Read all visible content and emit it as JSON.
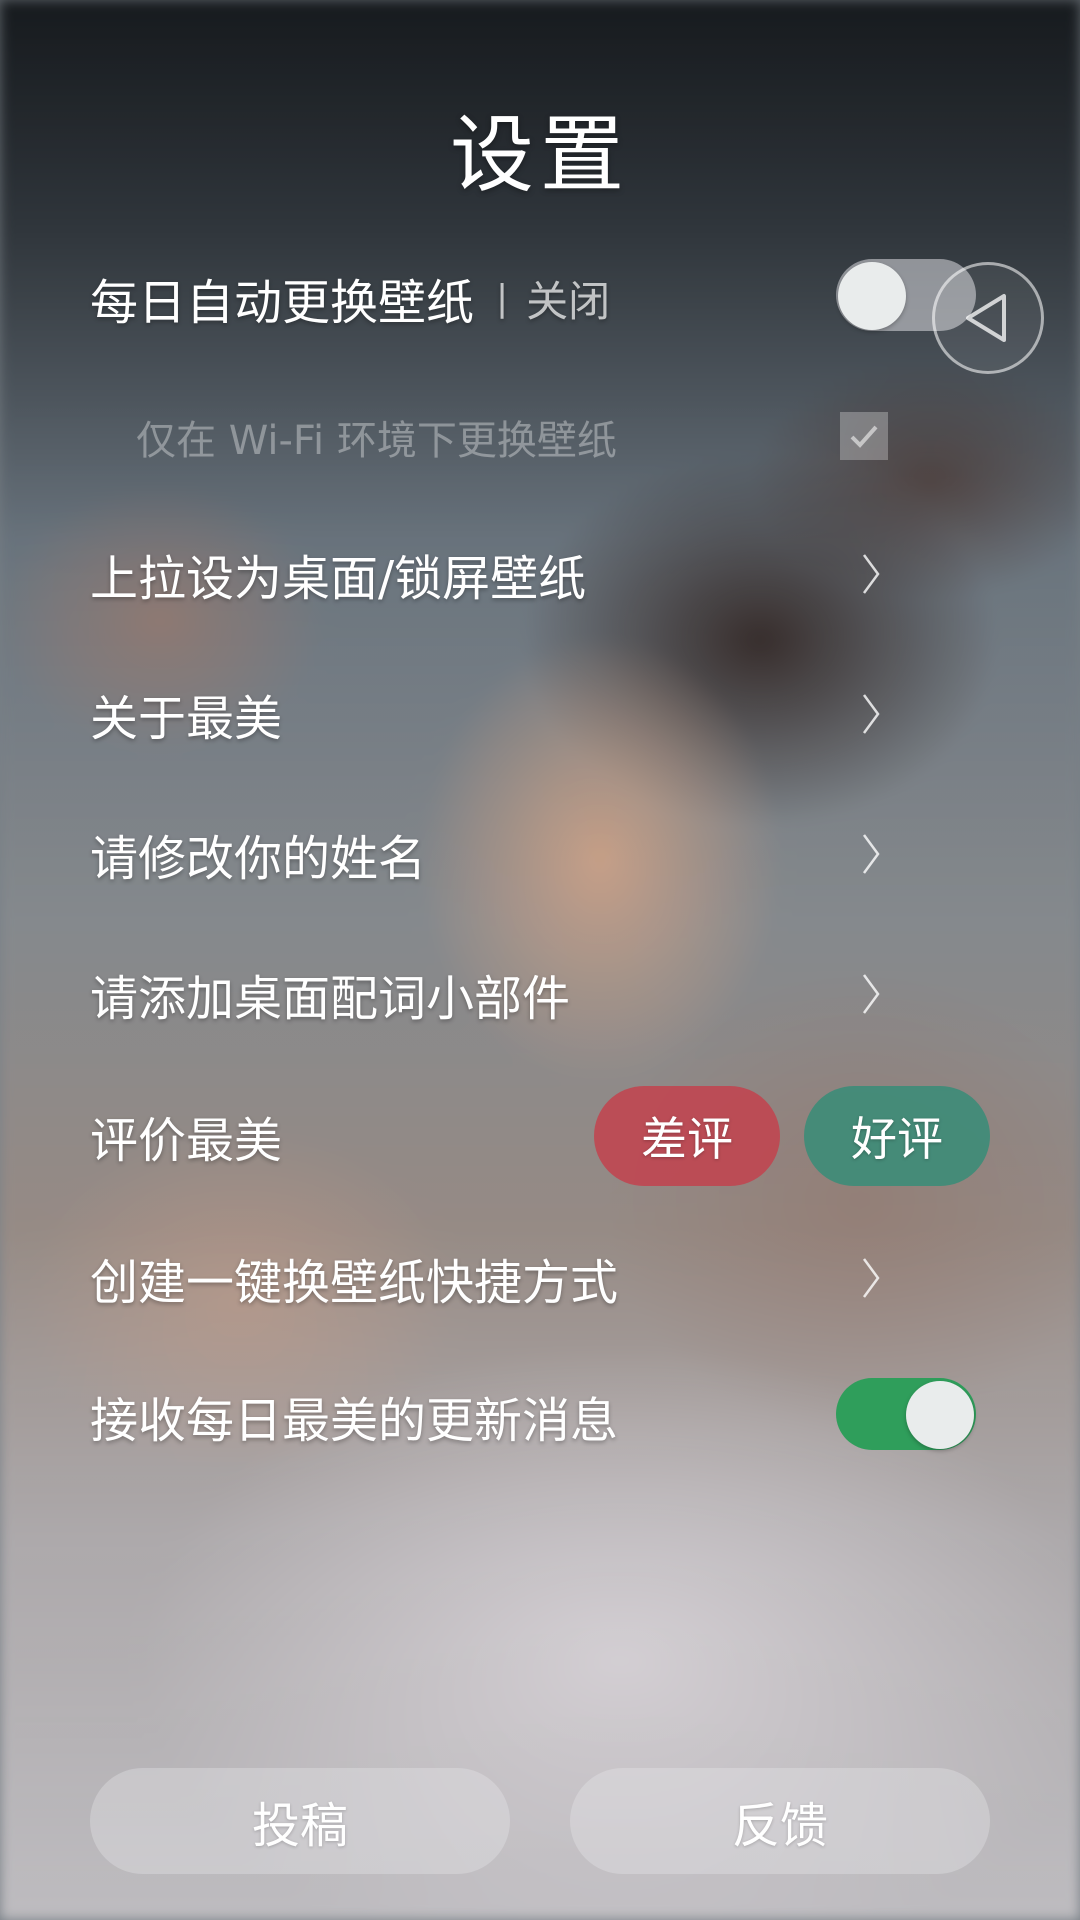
{
  "header": {
    "title": "设置"
  },
  "settings": {
    "auto_change": {
      "label": "每日自动更换壁纸",
      "separator": "|",
      "state": "关闭",
      "enabled": false
    },
    "wifi_only": {
      "label": "仅在 Wi-Fi 环境下更换壁纸",
      "checked": true
    },
    "swipe_set": {
      "label": "上拉设为桌面/锁屏壁纸"
    },
    "about": {
      "label": "关于最美"
    },
    "rename": {
      "label": "请修改你的姓名"
    },
    "widget": {
      "label": "请添加桌面配词小部件"
    },
    "rate": {
      "label": "评价最美",
      "bad_label": "差评",
      "good_label": "好评"
    },
    "shortcut": {
      "label": "创建一键换壁纸快捷方式"
    },
    "notifications": {
      "label": "接收每日最美的更新消息",
      "enabled": true
    }
  },
  "footer": {
    "submit_label": "投稿",
    "feedback_label": "反馈"
  },
  "icons": {
    "back": "back-triangle-icon",
    "chevron": "chevron-right-icon",
    "check": "check-icon"
  },
  "colors": {
    "toggle_on": "#2f9e5b",
    "bad": "#c4404c",
    "good": "#3a8c78"
  }
}
